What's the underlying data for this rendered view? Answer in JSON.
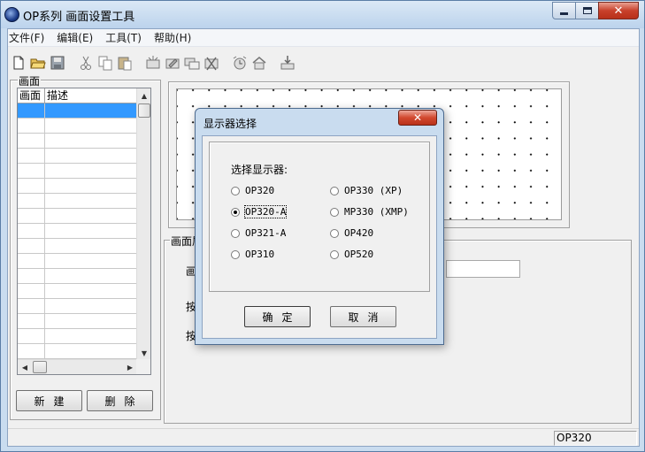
{
  "window": {
    "title": "OP系列 画面设置工具",
    "caption_close": "✕"
  },
  "menu": [
    {
      "label": "文件(F)"
    },
    {
      "label": "编辑(E)"
    },
    {
      "label": "工具(T)"
    },
    {
      "label": "帮助(H)"
    }
  ],
  "toolbar": [
    {
      "icon": "new-file-icon"
    },
    {
      "icon": "open-folder-icon"
    },
    {
      "icon": "save-icon"
    },
    {
      "icon": "cut-icon"
    },
    {
      "icon": "copy-icon"
    },
    {
      "icon": "paste-icon"
    },
    {
      "icon": "screen-add-icon"
    },
    {
      "icon": "screen-edit-icon"
    },
    {
      "icon": "screen-copy-icon"
    },
    {
      "icon": "screen-delete-icon"
    },
    {
      "icon": "alarm-icon"
    },
    {
      "icon": "home-icon"
    },
    {
      "icon": "download-icon"
    }
  ],
  "left_panel": {
    "group_label": "画面",
    "columns": [
      "画面",
      "描述"
    ],
    "new_button": "新建",
    "delete_button": "删除"
  },
  "settings_group": {
    "label": "画面属",
    "partial_labels": [
      "画",
      "按",
      "按"
    ]
  },
  "status": {
    "model": "OP320"
  },
  "dialog": {
    "title": "显示器选择",
    "close": "✕",
    "prompt": "选择显示器:",
    "options": [
      {
        "label": "OP320",
        "selected": false
      },
      {
        "label": "OP330 (XP)",
        "selected": false
      },
      {
        "label": "OP320-A",
        "selected": true
      },
      {
        "label": "MP330 (XMP)",
        "selected": false
      },
      {
        "label": "OP321-A",
        "selected": false
      },
      {
        "label": "OP420",
        "selected": false
      },
      {
        "label": "OP310",
        "selected": false
      },
      {
        "label": "OP520",
        "selected": false
      }
    ],
    "ok_button": "确定",
    "cancel_button": "取消"
  }
}
